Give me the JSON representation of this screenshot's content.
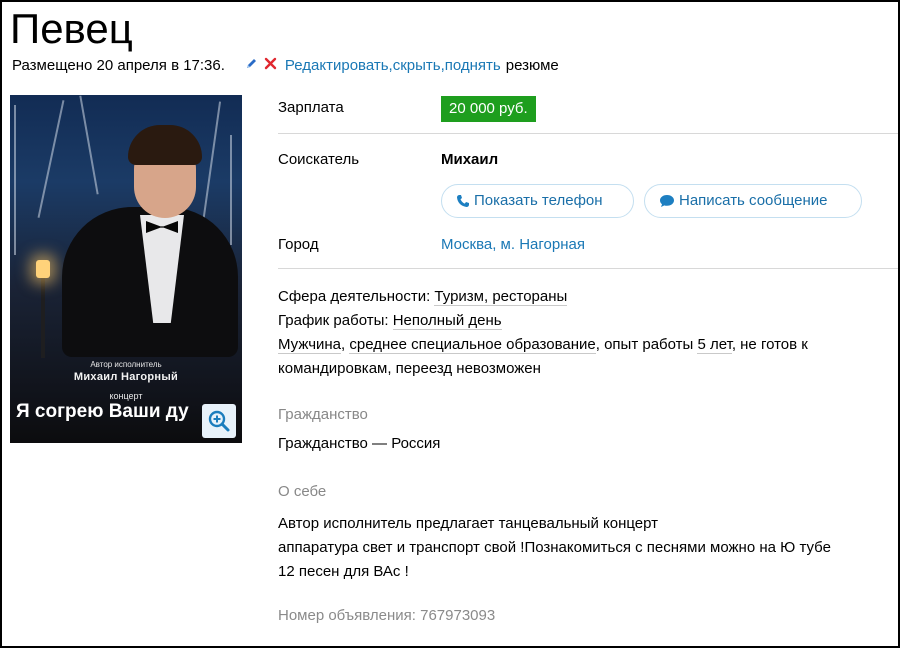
{
  "page": {
    "title": "Певец"
  },
  "meta": {
    "posted": "Размещено 20 апреля в 17:36.",
    "edit_link": "Редактировать",
    "sep1": ", ",
    "hide_link": "скрыть",
    "sep2": ", ",
    "raise_link": "поднять",
    "suffix": "резюме",
    "pencil_icon": "pencil-icon",
    "close_icon": "close-icon"
  },
  "photo": {
    "poster_small": "Автор исполнитель",
    "poster_name": "Михаил   Нагорный",
    "poster_concert": "концерт",
    "poster_title": "Я согрею Ваши ду"
  },
  "salary": {
    "label": "Зарплата",
    "value": "20 000 руб.",
    "color": "#1e9e1e"
  },
  "seeker": {
    "label": "Соискатель",
    "name": "Михаил",
    "show_phone": "Показать телефон",
    "write_message": "Написать сообщение"
  },
  "city": {
    "label": "Город",
    "value": "Москва, м. Нагорная"
  },
  "details": {
    "sphere_label": "Сфера деятельности: ",
    "sphere_value": "Туризм, рестораны",
    "schedule_label": "График работы: ",
    "schedule_value": "Неполный день",
    "gender": "Мужчина",
    "c1": ", ",
    "education": "среднее специальное образование",
    "c2": ", опыт работы ",
    "experience": "5 лет",
    "c3": ", не готов к командировкам, переезд невозможен"
  },
  "citizenship": {
    "title": "Гражданство",
    "value": "Гражданство — Россия"
  },
  "about": {
    "title": "О себе",
    "line1": "Автор исполнитель предлагает танцевальный концерт",
    "line2": "аппаратура свет и транспорт свой !Познакомиться с песнями можно на Ю тубе",
    "line3": "12 песен для ВАс !"
  },
  "ad": {
    "number_text": "Номер объявления: 767973093"
  },
  "colors": {
    "link": "#1a78b5",
    "accent_green": "#1e9e1e",
    "muted": "#888888"
  }
}
